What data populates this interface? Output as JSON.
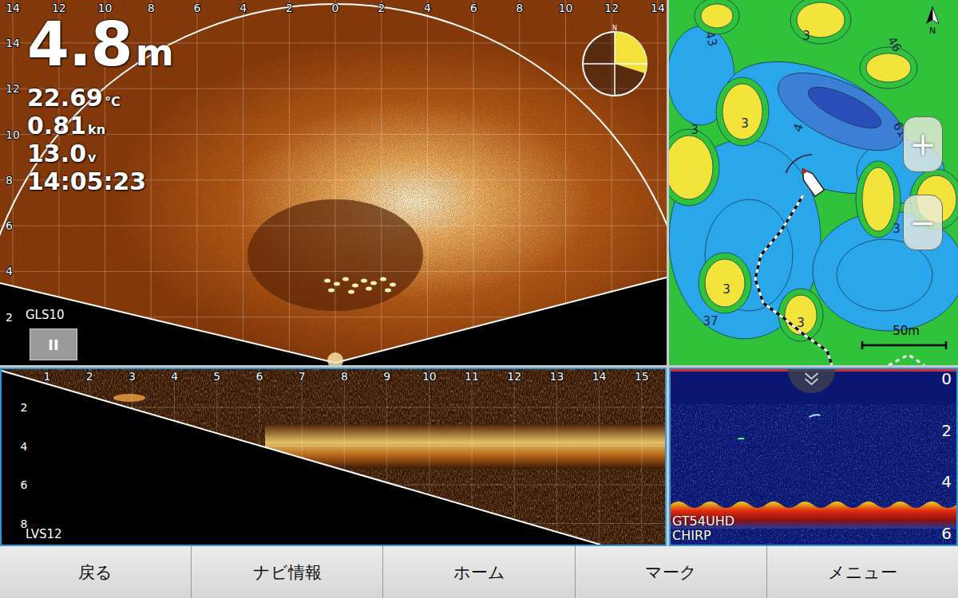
{
  "sidescan": {
    "label": "GLS10",
    "depth": "4.8",
    "depth_unit": "m",
    "readings": [
      {
        "value": "22.69",
        "unit": "°C"
      },
      {
        "value": "0.81",
        "unit": "kn"
      },
      {
        "value": "13.0",
        "unit": "v"
      }
    ],
    "time": "14:05:23",
    "pause_icon": "II",
    "compass_north": "N",
    "x_ticks": [
      "14",
      "12",
      "10",
      "8",
      "6",
      "4",
      "2",
      "0",
      "2",
      "4",
      "6",
      "8",
      "10",
      "12",
      "14"
    ],
    "y_ticks": [
      "14",
      "12",
      "10",
      "8",
      "6",
      "4",
      "2"
    ]
  },
  "livescope": {
    "label": "LVS12",
    "x_ticks": [
      "1",
      "2",
      "3",
      "4",
      "5",
      "6",
      "7",
      "8",
      "9",
      "10",
      "11",
      "12",
      "13",
      "14",
      "15"
    ],
    "y_ticks": [
      "2",
      "4",
      "6",
      "8"
    ]
  },
  "map": {
    "north": "N",
    "contour_labels": [
      "43",
      "3",
      "46",
      "3",
      "3",
      "4",
      "61",
      "3",
      "3",
      "37",
      "3"
    ],
    "zoom_in": "+",
    "zoom_out": "−",
    "scale": "50m"
  },
  "sonar": {
    "labels": [
      "GT54UHD",
      "CHIRP"
    ],
    "depth_ticks": [
      "0",
      "2",
      "4",
      "6"
    ]
  },
  "buttons": [
    {
      "label": "戻る"
    },
    {
      "label": "ナビ情報"
    },
    {
      "label": "ホーム"
    },
    {
      "label": "マーク"
    },
    {
      "label": "メニュー"
    }
  ]
}
